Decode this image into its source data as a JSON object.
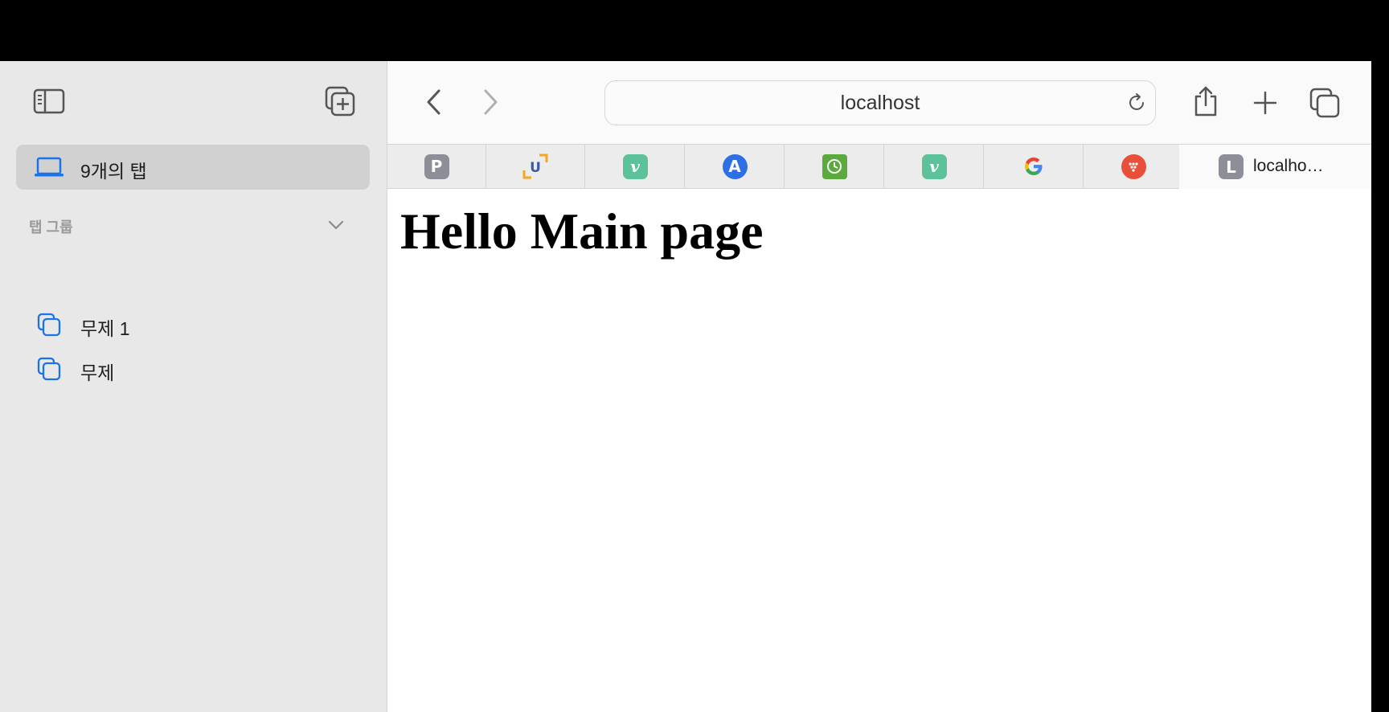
{
  "sidebar": {
    "tabs_label": "9개의 탭",
    "group_header": "탭 그룹",
    "groups": [
      {
        "label": "무제 1"
      },
      {
        "label": "무제"
      }
    ]
  },
  "toolbar": {
    "url": "localhost"
  },
  "tabstrip": {
    "pinned": [
      {
        "icon": "p-letter-icon",
        "letter": "P",
        "color": "#8e8e98"
      },
      {
        "icon": "u-bracket-icon",
        "letter": "U",
        "color": "#f5a623"
      },
      {
        "icon": "vimeo-icon",
        "letter": "v",
        "color": "#5cc29a"
      },
      {
        "icon": "a-letter-icon",
        "letter": "A",
        "color": "#2f6fe4"
      },
      {
        "icon": "green-clock-icon",
        "letter": "",
        "color": "#5aaa3e"
      },
      {
        "icon": "vimeo-icon",
        "letter": "v",
        "color": "#5cc29a"
      },
      {
        "icon": "google-icon",
        "letter": "G",
        "color": "#ffffff"
      },
      {
        "icon": "red-dots-icon",
        "letter": "",
        "color": "#e8503a"
      }
    ],
    "active": {
      "letter": "L",
      "title": "localho…",
      "color": "#8e8e98"
    }
  },
  "page": {
    "heading": "Hello Main page"
  }
}
